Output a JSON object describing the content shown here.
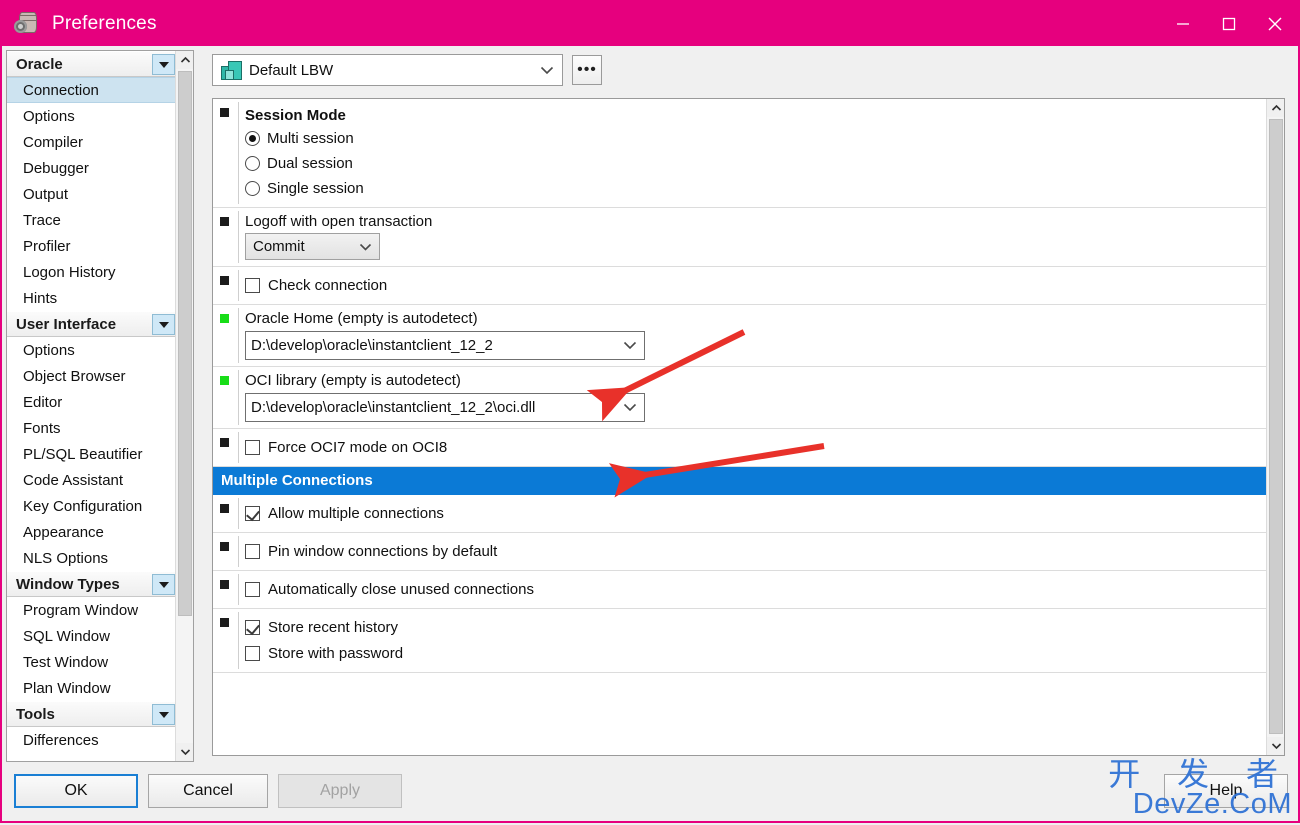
{
  "window": {
    "title": "Preferences",
    "icon": "database-gear-icon",
    "accent_color": "#e6007e",
    "controls": {
      "minimize": "minimize-icon",
      "maximize": "maximize-icon",
      "close": "close-icon"
    }
  },
  "sidebar": {
    "groups": [
      {
        "label": "Oracle",
        "expanded": true,
        "items": [
          {
            "label": "Connection",
            "selected": true
          },
          {
            "label": "Options",
            "selected": false
          },
          {
            "label": "Compiler",
            "selected": false
          },
          {
            "label": "Debugger",
            "selected": false
          },
          {
            "label": "Output",
            "selected": false
          },
          {
            "label": "Trace",
            "selected": false
          },
          {
            "label": "Profiler",
            "selected": false
          },
          {
            "label": "Logon History",
            "selected": false
          },
          {
            "label": "Hints",
            "selected": false
          }
        ]
      },
      {
        "label": "User Interface",
        "expanded": true,
        "items": [
          {
            "label": "Options",
            "selected": false
          },
          {
            "label": "Object Browser",
            "selected": false
          },
          {
            "label": "Editor",
            "selected": false
          },
          {
            "label": "Fonts",
            "selected": false
          },
          {
            "label": "PL/SQL Beautifier",
            "selected": false
          },
          {
            "label": "Code Assistant",
            "selected": false
          },
          {
            "label": "Key Configuration",
            "selected": false
          },
          {
            "label": "Appearance",
            "selected": false
          },
          {
            "label": "NLS Options",
            "selected": false
          }
        ]
      },
      {
        "label": "Window Types",
        "expanded": true,
        "items": [
          {
            "label": "Program Window",
            "selected": false
          },
          {
            "label": "SQL Window",
            "selected": false
          },
          {
            "label": "Test Window",
            "selected": false
          },
          {
            "label": "Plan Window",
            "selected": false
          }
        ]
      },
      {
        "label": "Tools",
        "expanded": true,
        "items": [
          {
            "label": "Differences",
            "selected": false
          }
        ]
      }
    ],
    "scrollbar": {
      "up": "chevron-up-icon",
      "down": "chevron-down-icon"
    }
  },
  "toolbar": {
    "profile_value": "Default LBW",
    "profile_icon": "lbw-blocks-icon",
    "profile_chevron": "chevron-down-icon",
    "more_button_label": "•••"
  },
  "options": {
    "scrollbar": {
      "up": "chevron-up-icon",
      "down": "chevron-down-icon"
    },
    "session_mode": {
      "heading": "Session Mode",
      "marker": "black",
      "selected": "Multi session",
      "choices": [
        {
          "label": "Multi session",
          "checked": true
        },
        {
          "label": "Dual session",
          "checked": false
        },
        {
          "label": "Single session",
          "checked": false
        }
      ]
    },
    "logoff": {
      "marker": "black",
      "label": "Logoff with open transaction",
      "value": "Commit",
      "chevron": "chevron-down-icon"
    },
    "check_connection": {
      "marker": "black",
      "label": "Check connection",
      "checked": false
    },
    "oracle_home": {
      "marker": "green",
      "label": "Oracle Home (empty is autodetect)",
      "value": "D:\\develop\\oracle\\instantclient_12_2",
      "chevron": "chevron-down-icon"
    },
    "oci_library": {
      "marker": "green",
      "label": "OCI library (empty is autodetect)",
      "value": "D:\\develop\\oracle\\instantclient_12_2\\oci.dll",
      "chevron": "chevron-down-icon"
    },
    "force_oci7": {
      "marker": "black",
      "label": "Force OCI7 mode on OCI8",
      "checked": false
    },
    "multiple_connections_header": {
      "label": "Multiple Connections",
      "background": "#0b7ad6",
      "color": "#ffffff"
    },
    "allow_multiple": {
      "marker": "black",
      "label": "Allow multiple connections",
      "checked": true
    },
    "pin_window": {
      "marker": "black",
      "label": "Pin window connections by default",
      "checked": false
    },
    "auto_close": {
      "marker": "black",
      "label": "Automatically close unused connections",
      "checked": false
    },
    "store_history": {
      "marker": "black",
      "label": "Store recent history",
      "checked": true,
      "sub_label": "Store with password",
      "sub_checked": false
    }
  },
  "footer": {
    "ok": "OK",
    "cancel": "Cancel",
    "apply": "Apply",
    "help": "Help"
  },
  "annotations": {
    "arrow_color": "#e8312a",
    "arrows": [
      {
        "name": "arrow-to-oracle-home",
        "target": "Oracle Home path field"
      },
      {
        "name": "arrow-to-oci-library",
        "target": "OCI library path field"
      }
    ]
  },
  "watermark": {
    "chinese": "开 发 者",
    "latin": "DevZe.CoM",
    "color": "#2b6fd4"
  }
}
